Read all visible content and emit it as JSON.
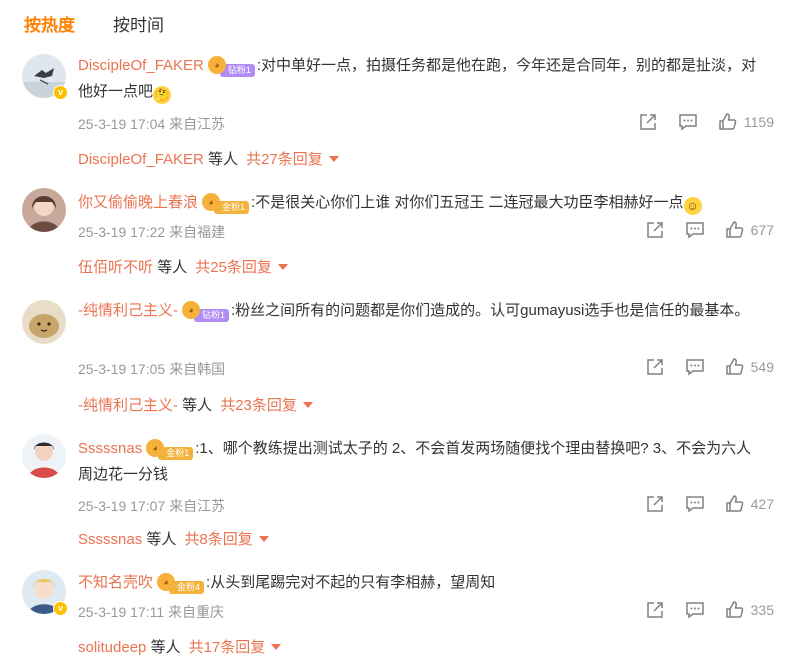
{
  "tabs": [
    {
      "label": "按热度",
      "active": true
    },
    {
      "label": "按时间",
      "active": false
    }
  ],
  "comments": [
    {
      "username": "DiscipleOf_FAKER",
      "fan_level": "钻粉1",
      "fan_type": "diamond",
      "text": ":对中单好一点，拍摄任务都是他在跑，今年还是合同年，别的都是扯淡，对他好一点吧",
      "emoji": "thinking-emoji",
      "time": "25-3-19 17:04",
      "location": "来自江苏",
      "likes": "1159",
      "reply_user": "DiscipleOf_FAKER",
      "reply_suffix": "等人",
      "reply_total": "共27条回复"
    },
    {
      "username": "你又偷偷晚上春浪",
      "fan_level": "金粉1",
      "fan_type": "gold",
      "text": ":不是很关心你们上谁 对你们五冠王 二连冠最大功臣李相赫好一点",
      "emoji": "smile-emoji",
      "time": "25-3-19 17:22",
      "location": "来自福建",
      "likes": "677",
      "reply_user": "伍佰听不听",
      "reply_suffix": "等人",
      "reply_total": "共25条回复"
    },
    {
      "username": "-纯情利己主义-",
      "fan_level": "钻粉1",
      "fan_type": "diamond",
      "text": ":粉丝之间所有的问题都是你们造成的。认可gumayusi选手也是信任的最基本。",
      "emoji": "",
      "time": "25-3-19 17:05",
      "location": "来自韩国",
      "likes": "549",
      "reply_user": "-纯情利己主义-",
      "reply_suffix": "等人",
      "reply_total": "共23条回复"
    },
    {
      "username": "Sssssnas",
      "fan_level": "金粉1",
      "fan_type": "gold",
      "text": ":1、哪个教练提出测试太子的 2、不会首发两场随便找个理由替换吧? 3、不会为六人周边花一分钱",
      "emoji": "",
      "time": "25-3-19 17:07",
      "location": "来自江苏",
      "likes": "427",
      "reply_user": "Sssssnas",
      "reply_suffix": "等人",
      "reply_total": "共8条回复"
    },
    {
      "username": "不知名壳吹",
      "fan_level": "金粉4",
      "fan_type": "gold",
      "text": ":从头到尾踢完对不起的只有李相赫，望周知",
      "emoji": "",
      "time": "25-3-19 17:11",
      "location": "来自重庆",
      "likes": "335",
      "reply_user": "solitudeep",
      "reply_suffix": "等人",
      "reply_total": "共17条回复"
    }
  ],
  "icons": {
    "share": "share-icon",
    "comment": "comment-icon",
    "like": "like-icon",
    "caret": "caret-down-icon"
  },
  "colors": {
    "accent": "#ff8200",
    "username": "#eb7350",
    "meta": "#999999"
  }
}
